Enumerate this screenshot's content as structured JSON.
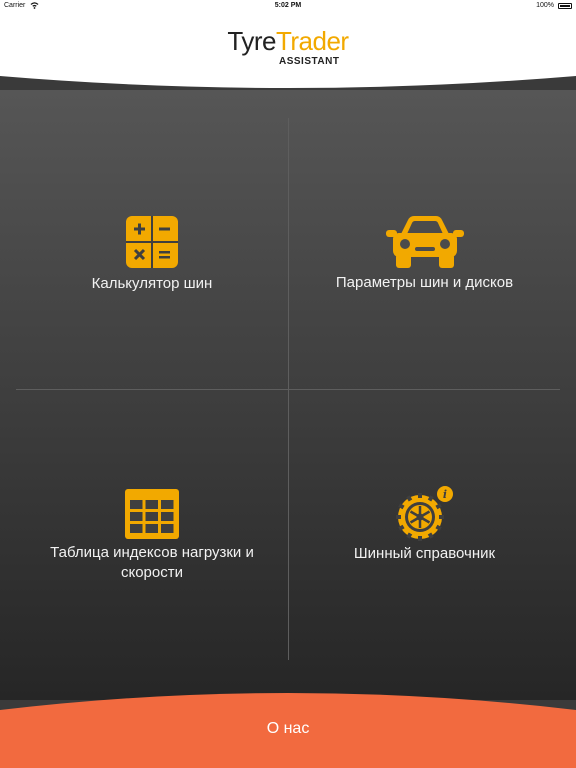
{
  "status_bar": {
    "carrier": "Carrier",
    "time": "5:02 PM",
    "battery": "100%"
  },
  "header": {
    "logo_part1": "Tyre",
    "logo_part2": "Trader",
    "logo_sub": "ASSISTANT"
  },
  "menu": {
    "calculator": "Калькулятор шин",
    "parameters": "Параметры шин и дисков",
    "index_table_line1": "Таблица индексов нагрузки и",
    "index_table_line2": "скорости",
    "reference": "Шинный справочник"
  },
  "footer": {
    "about": "О нас"
  },
  "colors": {
    "accent": "#f2a900",
    "footer": "#f26a3f",
    "background": "#3a3a3a"
  },
  "icons": [
    "wifi-icon",
    "battery-icon",
    "calculator-icon",
    "car-icon",
    "table-icon",
    "tyre-info-icon"
  ]
}
